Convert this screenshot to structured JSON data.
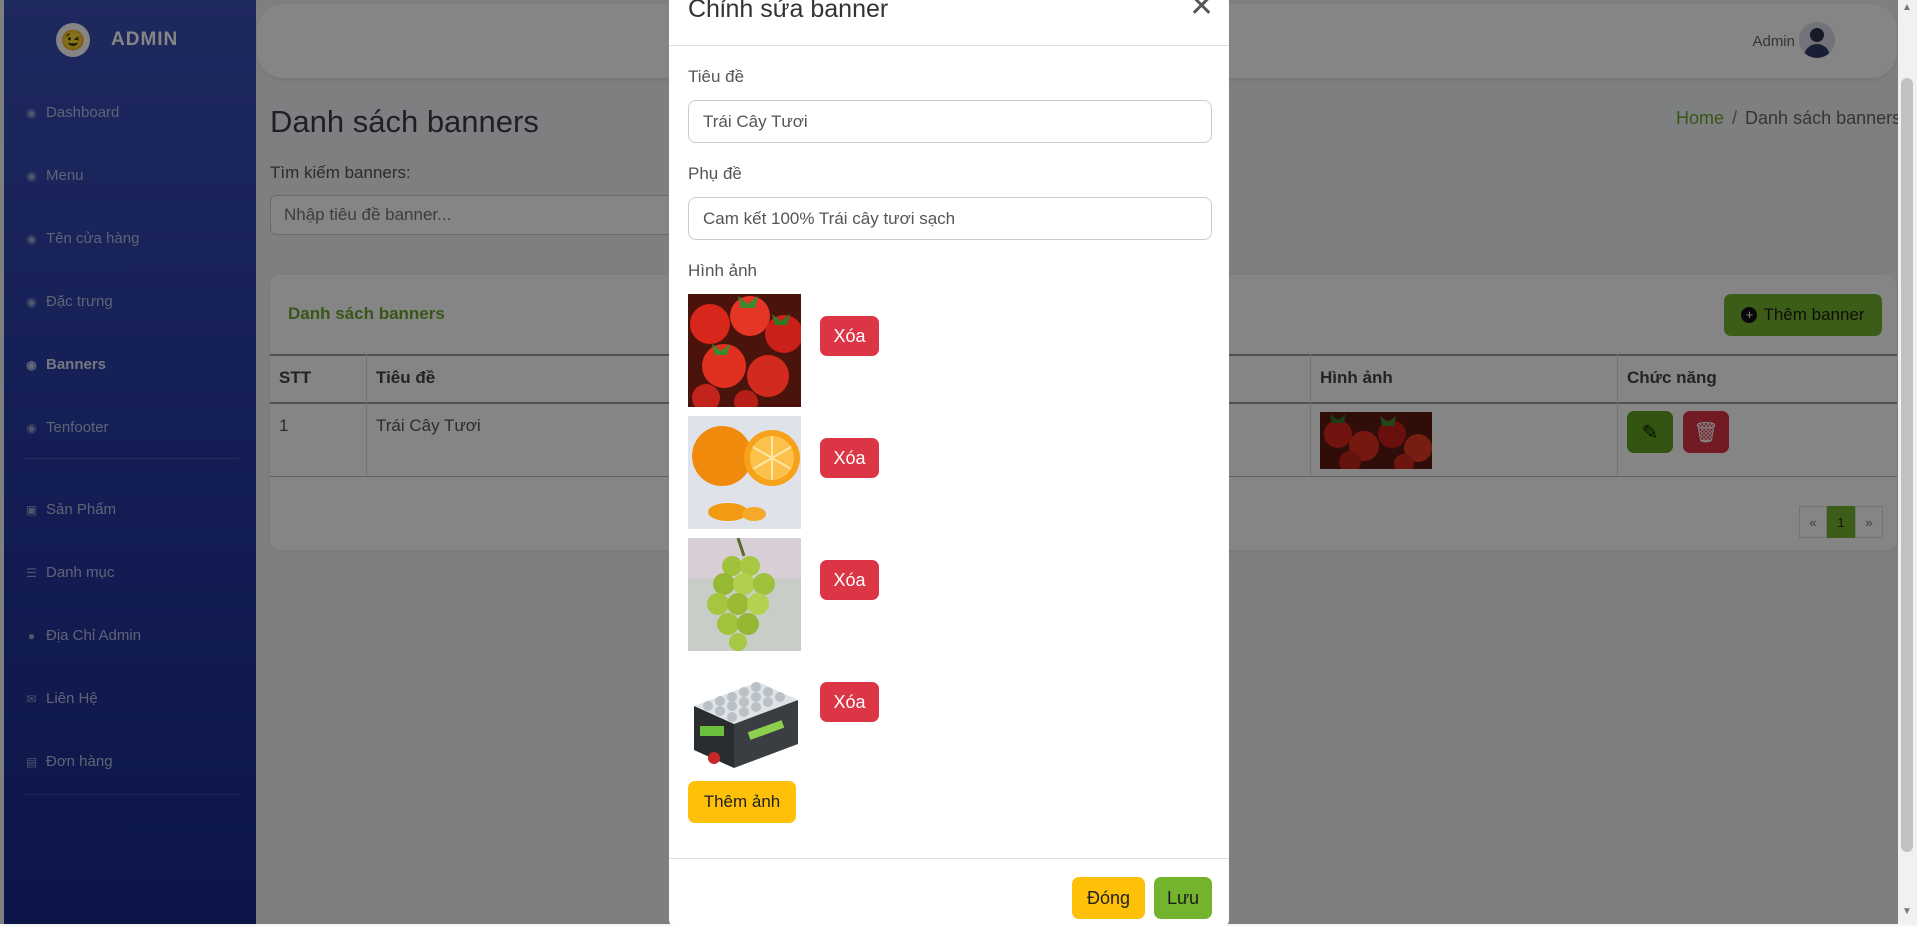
{
  "brand": {
    "logo_glyph": "😉",
    "name": "ADMIN"
  },
  "sidebar": {
    "items": [
      {
        "label": "Dashboard",
        "icon": "dashboard-icon"
      },
      {
        "label": "Menu",
        "icon": "dashboard-icon"
      },
      {
        "label": "Tên cửa hàng",
        "icon": "dashboard-icon"
      },
      {
        "label": "Đặc trưng",
        "icon": "dashboard-icon"
      },
      {
        "label": "Banners",
        "icon": "dashboard-icon",
        "active": true
      },
      {
        "label": "Tenfooter",
        "icon": "dashboard-icon"
      },
      {
        "label": "Sản Phẩm",
        "icon": "box-icon"
      },
      {
        "label": "Danh mục",
        "icon": "list-icon"
      },
      {
        "label": "Địa Chỉ Admin",
        "icon": "location-pin-icon"
      },
      {
        "label": "Liên Hệ",
        "icon": "envelope-icon"
      },
      {
        "label": "Đơn hàng",
        "icon": "id-card-icon"
      }
    ]
  },
  "topbar": {
    "user_name": "Admin"
  },
  "page": {
    "title": "Danh sách banners",
    "breadcrumb": {
      "home": "Home",
      "separator": "/",
      "current": "Danh sách banners"
    },
    "search": {
      "label": "Tìm kiếm banners:",
      "placeholder": "Nhập tiêu đề banner..."
    }
  },
  "card": {
    "title": "Danh sách banners",
    "add_button": "Thêm banner",
    "columns": [
      "STT",
      "Tiêu đề",
      "Hình ảnh",
      "Chức năng"
    ],
    "rows": [
      {
        "stt": "1",
        "title": "Trái Cây Tươi"
      }
    ],
    "pagination": {
      "prev": "«",
      "current": "1",
      "next": "»"
    }
  },
  "modal": {
    "title": "Chỉnh sửa banner",
    "title_label": "Tiêu đề",
    "title_value": "Trái Cây Tươi",
    "subtitle_label": "Phụ đề",
    "subtitle_value": "Cam kết 100% Trái cây tươi sạch",
    "images_label": "Hình ảnh",
    "images": [
      {
        "subject": "strawberries"
      },
      {
        "subject": "orange"
      },
      {
        "subject": "green grapes"
      },
      {
        "subject": "drink cans pack"
      }
    ],
    "remove_label": "Xóa",
    "add_image_label": "Thêm ảnh",
    "close_label": "Đóng",
    "save_label": "Lưu"
  },
  "colors": {
    "sidebar_top": "#3a4fb4",
    "sidebar_bottom": "#172a8a",
    "accent_green": "#74b32c",
    "danger_red": "#dc3545",
    "warning_yellow": "#ffc107"
  }
}
